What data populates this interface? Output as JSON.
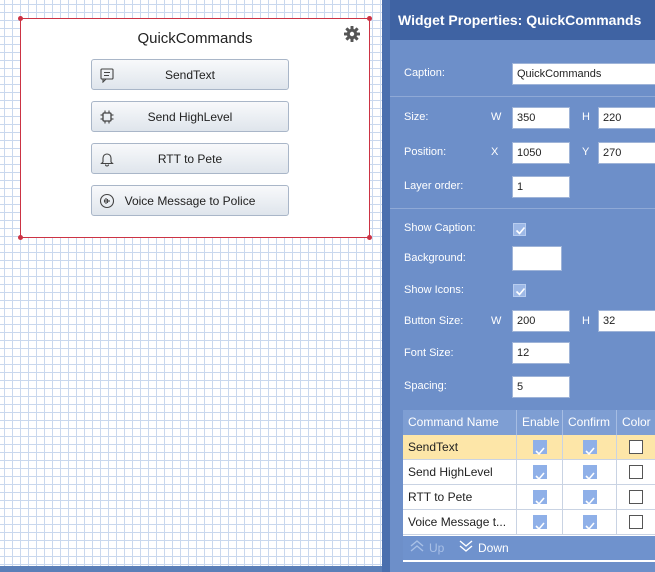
{
  "widget": {
    "caption": "QuickCommands",
    "buttons": [
      {
        "label": "SendText",
        "icon": "message-icon"
      },
      {
        "label": "Send HighLevel",
        "icon": "chip-icon"
      },
      {
        "label": "RTT to Pete",
        "icon": "bell-icon"
      },
      {
        "label": "Voice Message to Police",
        "icon": "voice-icon"
      }
    ]
  },
  "panel": {
    "title": "Widget Properties: QuickCommands",
    "caption_label": "Caption:",
    "caption_value": "QuickCommands",
    "size_label": "Size:",
    "w_label": "W",
    "h_label": "H",
    "size_w": "350",
    "size_h": "220",
    "position_label": "Position:",
    "x_label": "X",
    "y_label": "Y",
    "pos_x": "1050",
    "pos_y": "270",
    "layer_label": "Layer order:",
    "layer_value": "1",
    "show_caption_label": "Show Caption:",
    "show_caption": true,
    "background_label": "Background:",
    "background_color": "#ffffff",
    "show_icons_label": "Show Icons:",
    "show_icons": true,
    "button_size_label": "Button Size:",
    "button_w": "200",
    "button_h": "32",
    "font_size_label": "Font Size:",
    "font_size": "12",
    "spacing_label": "Spacing:",
    "spacing": "5"
  },
  "grid": {
    "columns": [
      "Command Name",
      "Enable",
      "Confirm",
      "Color"
    ],
    "rows": [
      {
        "name": "SendText",
        "enable": true,
        "confirm": true,
        "color": false,
        "selected": true
      },
      {
        "name": "Send HighLevel",
        "enable": true,
        "confirm": true,
        "color": false,
        "selected": false
      },
      {
        "name": "RTT to Pete",
        "enable": true,
        "confirm": true,
        "color": false,
        "selected": false
      },
      {
        "name": "Voice Message t...",
        "enable": true,
        "confirm": true,
        "color": false,
        "selected": false
      }
    ],
    "up_label": "Up",
    "down_label": "Down"
  },
  "colors": {
    "accent": "#3f63a3",
    "panel_bg": "#6d8fc9",
    "selection": "#cc3344",
    "row_highlight": "#fde6a8"
  }
}
